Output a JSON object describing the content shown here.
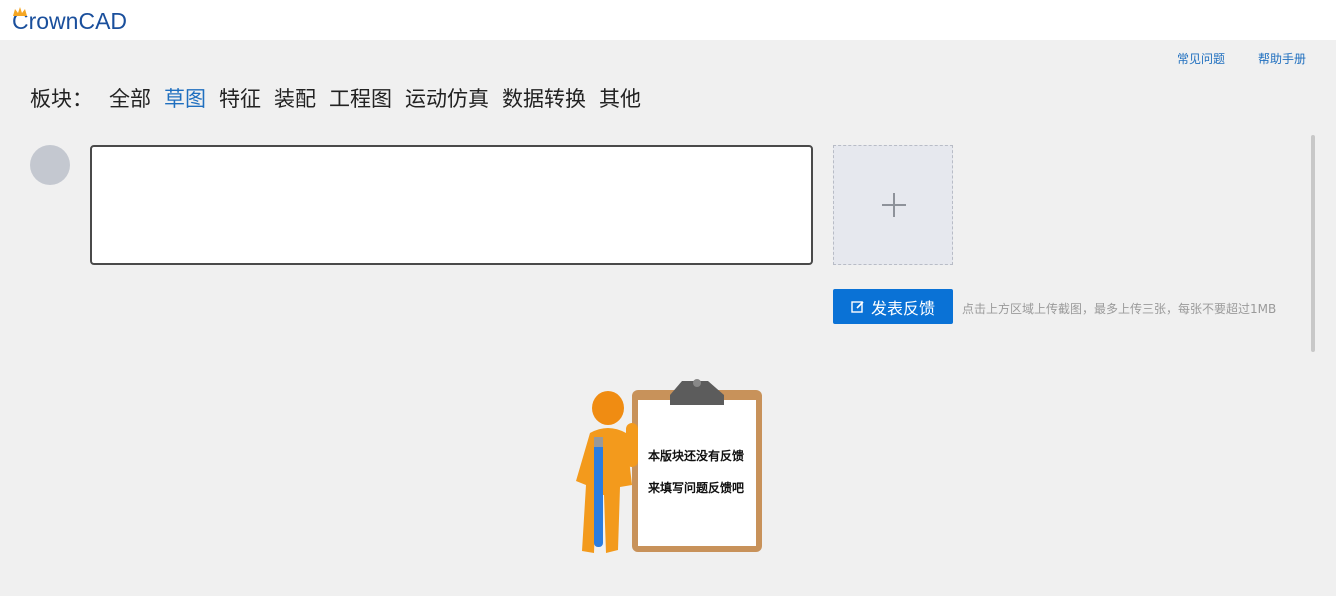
{
  "header": {
    "logo_text": "CrownCAD"
  },
  "help_links": {
    "faq": "常见问题",
    "manual": "帮助手册"
  },
  "sections": {
    "label": "板块：",
    "items": [
      "全部",
      "草图",
      "特征",
      "装配",
      "工程图",
      "运动仿真",
      "数据转换",
      "其他"
    ],
    "active": "草图"
  },
  "feedback_form": {
    "textarea_value": "",
    "submit_label": "发表反馈",
    "upload_hint": "点击上方区域上传截图，最多上传三张，每张不要超过1MB"
  },
  "empty_state": {
    "line1": "本版块还没有反馈",
    "line2": "来填写问题反馈吧"
  },
  "colors": {
    "accent": "#0a72d6",
    "link": "#1f6fbf",
    "logo": "#1a4f9c"
  },
  "icons": {
    "upload": "plus-icon",
    "submit": "edit-icon",
    "logo": "crown-icon"
  }
}
